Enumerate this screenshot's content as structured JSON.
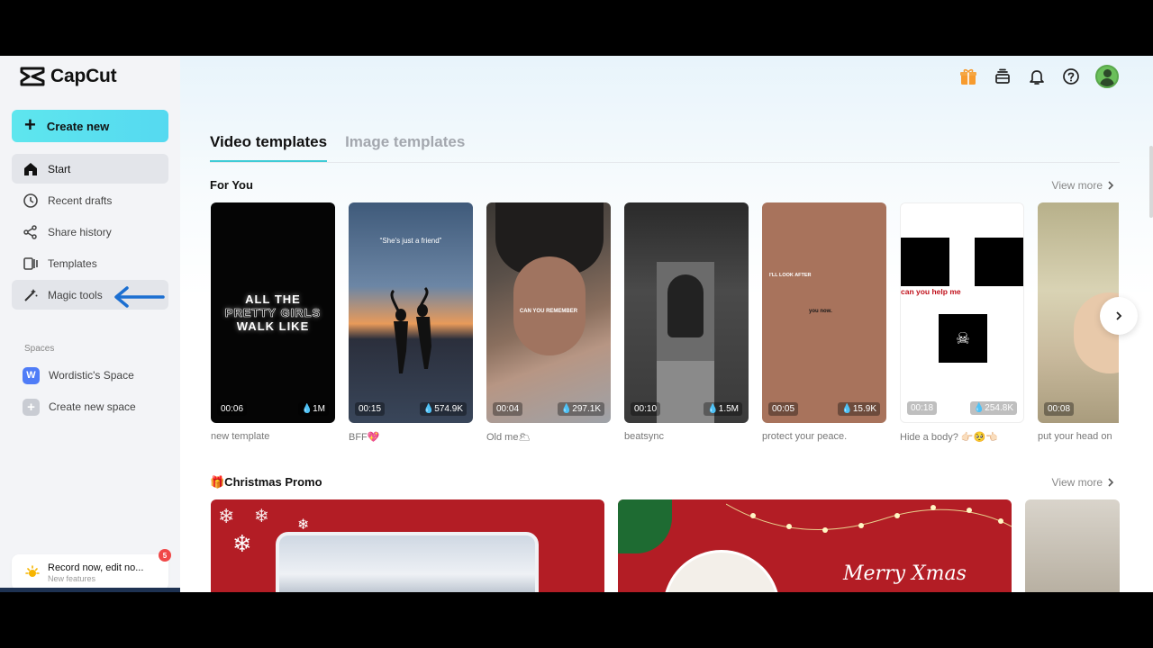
{
  "app": {
    "name": "CapCut"
  },
  "sidebar": {
    "create_label": "Create new",
    "items": [
      {
        "label": "Start",
        "icon": "home-icon"
      },
      {
        "label": "Recent drafts",
        "icon": "clock-icon"
      },
      {
        "label": "Share history",
        "icon": "share-icon"
      },
      {
        "label": "Templates",
        "icon": "templates-icon"
      },
      {
        "label": "Magic tools",
        "icon": "magic-wand-icon"
      }
    ],
    "spaces_header": "Spaces",
    "spaces": [
      {
        "label": "Wordistic's Space",
        "avatar_letter": "W"
      },
      {
        "label": "Create new space"
      }
    ],
    "record": {
      "title": "Record now, edit no...",
      "subtitle": "New features",
      "badge": "5"
    }
  },
  "header": {
    "icons": [
      "gift-icon",
      "layers-icon",
      "bell-icon",
      "help-icon",
      "avatar"
    ]
  },
  "tabs": [
    {
      "label": "Video templates",
      "active": true
    },
    {
      "label": "Image templates",
      "active": false
    }
  ],
  "for_you": {
    "title": "For You",
    "view_more": "View more",
    "cards": [
      {
        "title": "new template",
        "duration": "00:06",
        "uses": "1M",
        "overlay": [
          "ALL THE",
          "PRETTY GIRLS",
          "WALK LIKE"
        ]
      },
      {
        "title": "BFF💖",
        "duration": "00:15",
        "uses": "574.9K",
        "overlay": [
          "“She's just a friend”"
        ]
      },
      {
        "title": "Old me🌥",
        "duration": "00:04",
        "uses": "297.1K",
        "overlay": [
          "CAN YOU REMEMBER"
        ]
      },
      {
        "title": "beatsync",
        "duration": "00:10",
        "uses": "1.5M"
      },
      {
        "title": "protect your peace.",
        "duration": "00:05",
        "uses": "15.9K",
        "overlay": [
          "I'LL LOOK AFTER",
          "you now."
        ]
      },
      {
        "title": "Hide a body? 👉🏻🥺👈🏻",
        "duration": "00:18",
        "uses": "254.8K",
        "overlay": [
          "can you help me"
        ]
      },
      {
        "title": "put your head on",
        "duration": "00:08"
      }
    ]
  },
  "christmas": {
    "title": "🎁Christmas Promo",
    "view_more": "View more",
    "card2_text": "Merry Xmas"
  },
  "colors": {
    "accent": "#3ecbd6",
    "create_button": "#5ee6ee",
    "promo_red": "#b31d25"
  }
}
